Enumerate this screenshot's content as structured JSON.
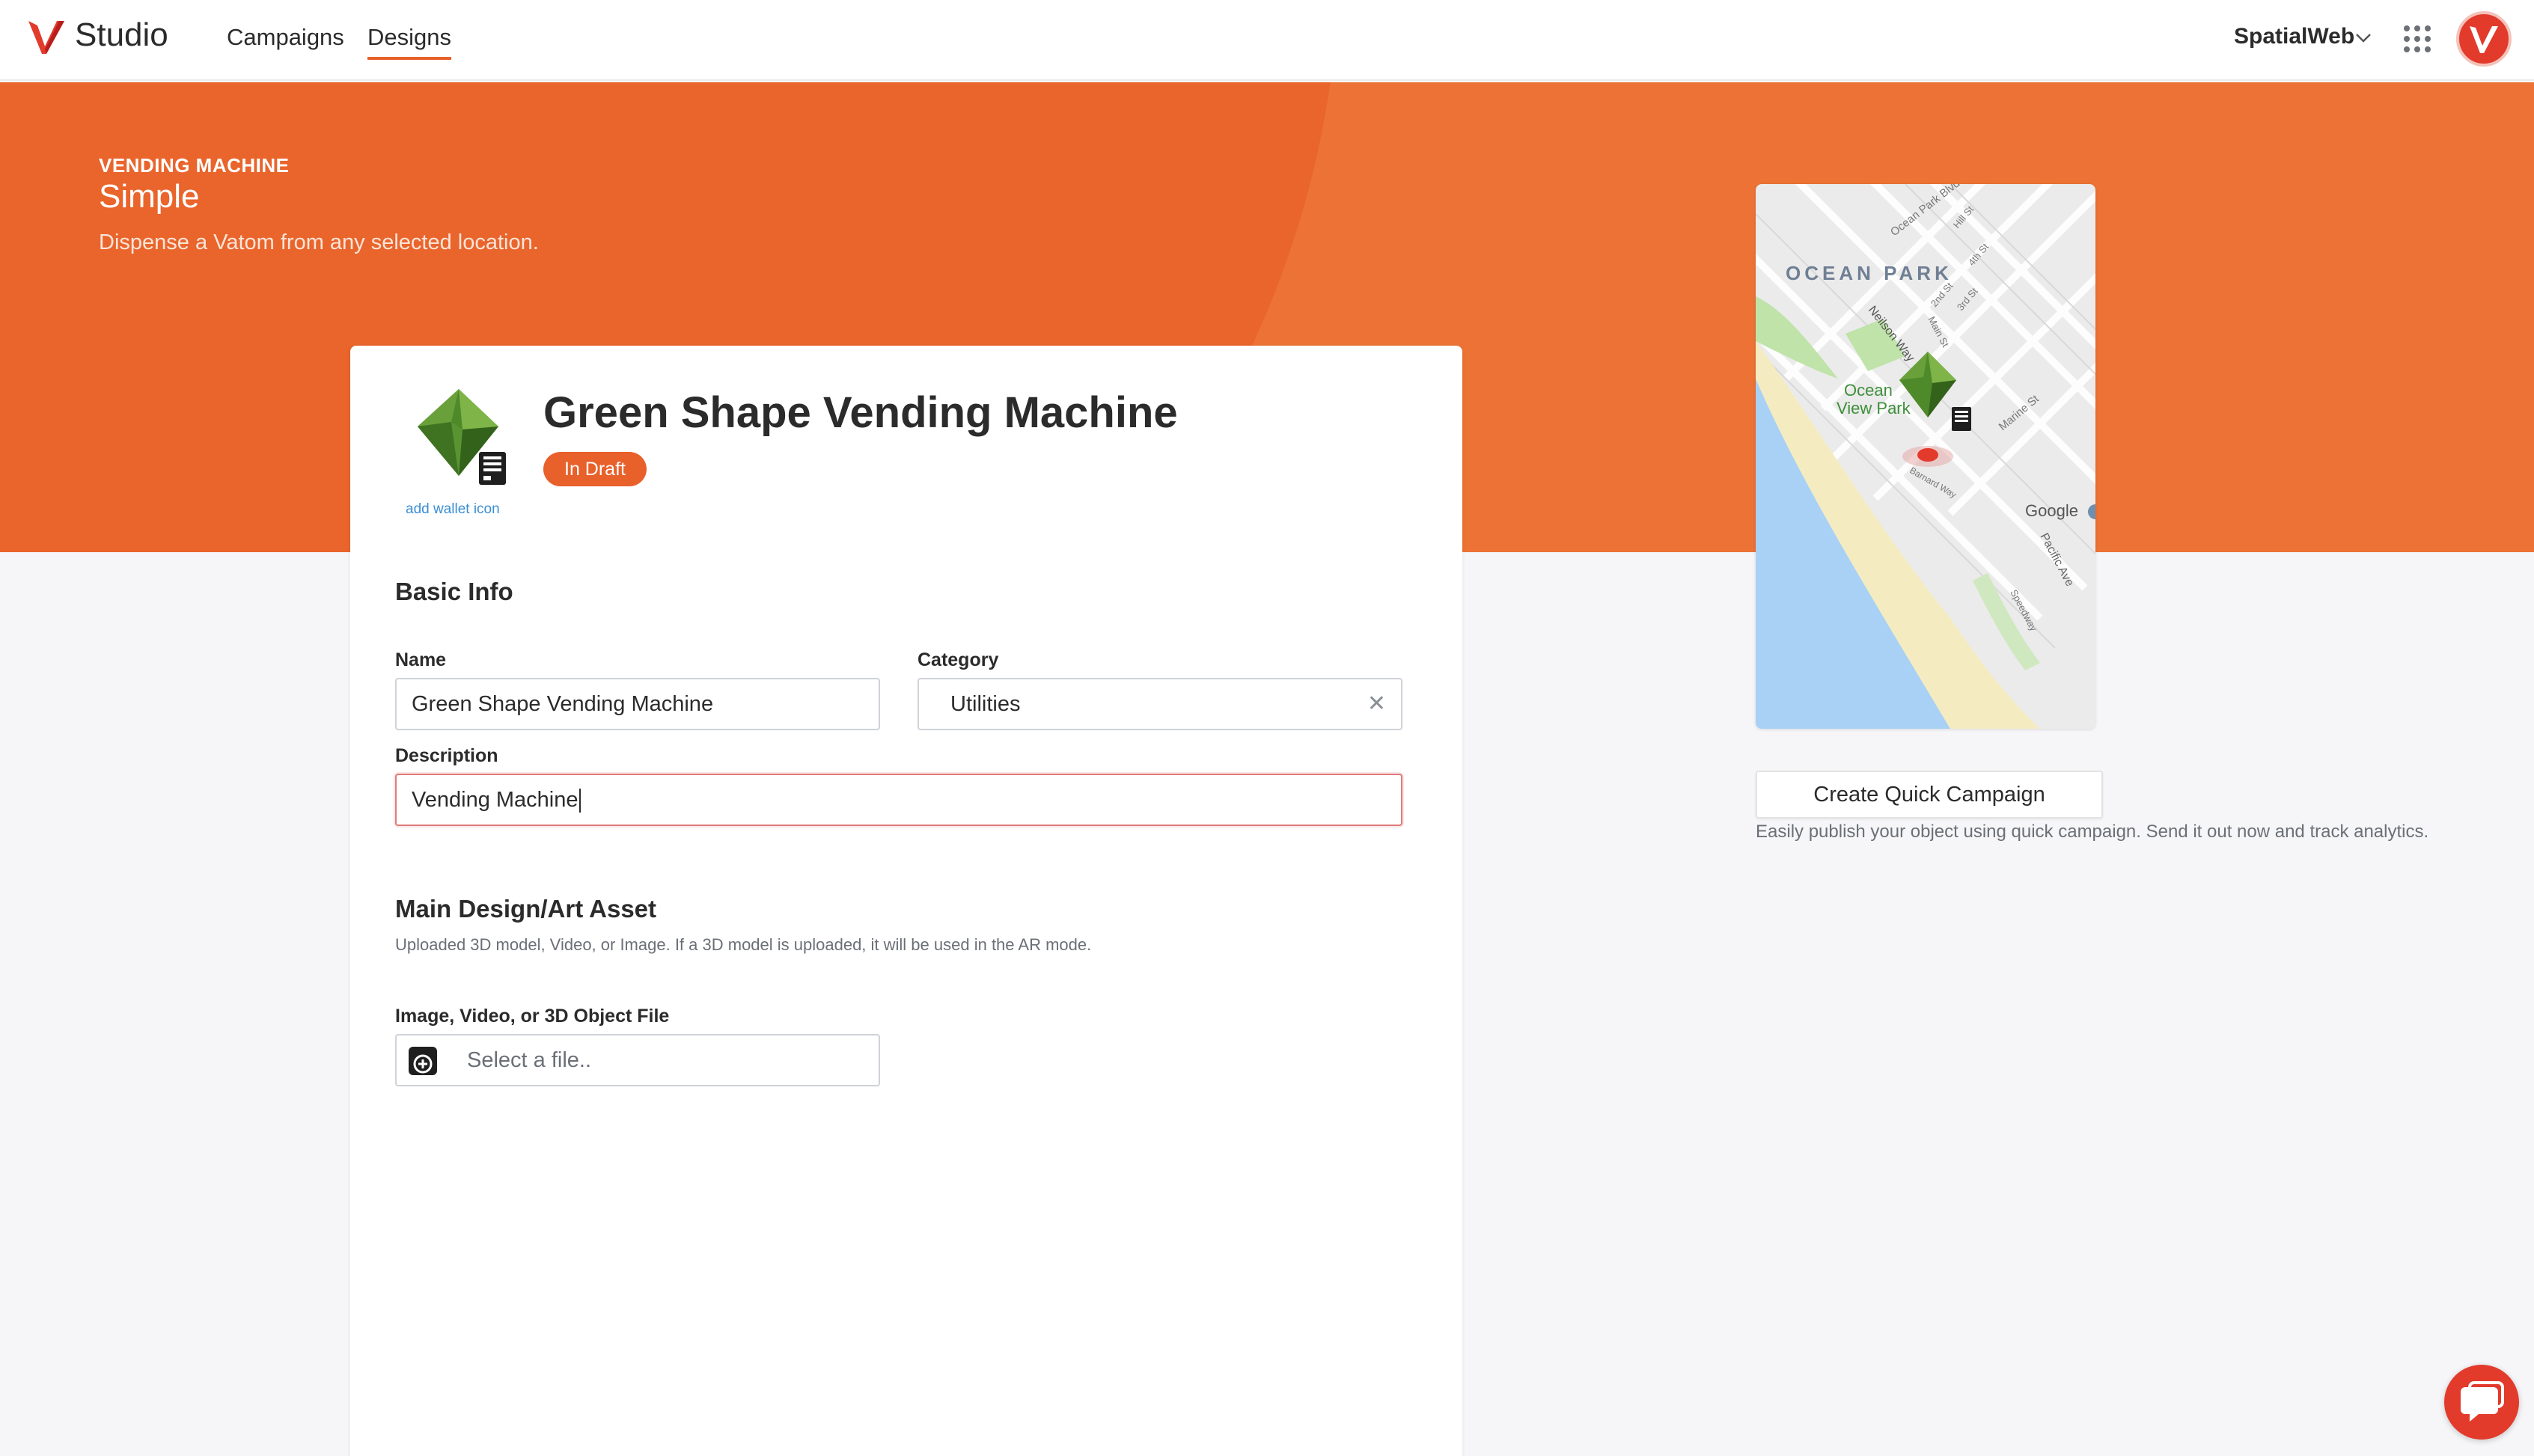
{
  "app": {
    "name": "Studio"
  },
  "nav": {
    "campaigns": "Campaigns",
    "designs": "Designs"
  },
  "header": {
    "org": "SpatialWeb"
  },
  "hero": {
    "kicker": "VENDING MACHINE",
    "title": "Simple",
    "subtitle": "Dispense a Vatom from any selected location."
  },
  "design": {
    "title": "Green Shape Vending Machine",
    "status": "In Draft",
    "wallet_icon_link": "add wallet icon"
  },
  "basic_info": {
    "heading": "Basic Info",
    "name_label": "Name",
    "name_value": "Green Shape Vending Machine",
    "category_label": "Category",
    "category_value": "Utilities",
    "description_label": "Description",
    "description_value": "Vending Machine"
  },
  "main_asset": {
    "heading": "Main Design/Art Asset",
    "note": "Uploaded 3D model, Video, or Image. If a 3D model is uploaded, it will be used in the AR mode.",
    "file_label": "Image, Video, or 3D Object File",
    "file_placeholder": "Select a file.."
  },
  "map": {
    "area": "OCEAN PARK",
    "park": "Ocean View Park",
    "attribution": "Google",
    "streets": [
      "Ocean Park Blvd",
      "Neilson Way",
      "Barnard Way",
      "Main St",
      "Marine St",
      "Pacific Ave",
      "Speedway",
      "Hill St",
      "4th St",
      "3rd St",
      "2nd St"
    ]
  },
  "quick_campaign": {
    "button": "Create Quick Campaign",
    "note": "Easily publish your object using quick campaign. Send it out now and track analytics."
  },
  "colors": {
    "accent": "#e8602a",
    "hero_bg": "#ec7335",
    "hero_shape": "#e9652c",
    "avatar": "#e23a2b",
    "map_water": "#a8d1f5",
    "map_sand": "#f4ecc0",
    "map_park": "#bfe3a9"
  },
  "icons": [
    "vatom-logo-icon",
    "chevron-down-icon",
    "apps-grid-icon",
    "user-avatar-icon",
    "close-icon",
    "plus-icon",
    "chat-icon",
    "vending-machine-icon",
    "green-gem-icon"
  ]
}
